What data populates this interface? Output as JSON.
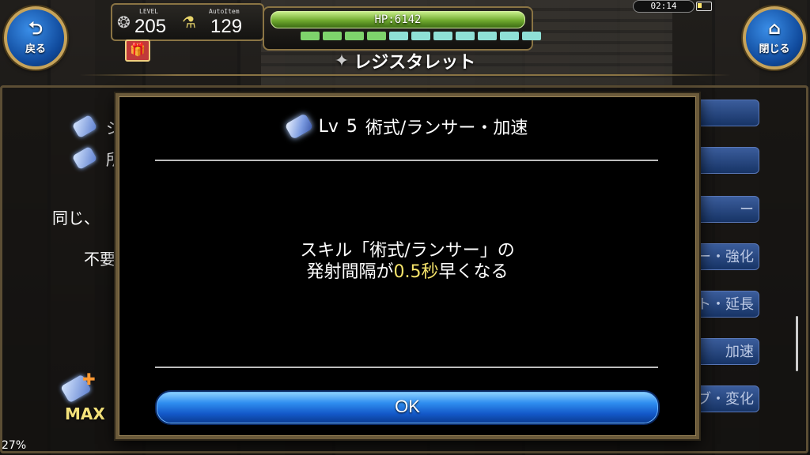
{
  "header": {
    "back_label": "戻る",
    "close_label": "閉じる",
    "level_label": "LEVEL",
    "level_value": "205",
    "autoitem_label": "AutoItem",
    "autoitem_value": "129",
    "hp_text": "HP:6142",
    "hp_segments": [
      "green",
      "green",
      "green",
      "green",
      "cyan",
      "cyan",
      "cyan",
      "cyan",
      "cyan",
      "cyan",
      "cyan"
    ],
    "clock": "02:14",
    "title": "レジスタレット"
  },
  "background": {
    "line1": "ジ",
    "line2": "所",
    "text1": "同じ、",
    "text2": "不要",
    "right_buttons": [
      "",
      "",
      "ー",
      "ー・強化",
      "ト・延長",
      "加速",
      "ブ・変化"
    ],
    "max_label": "MAX",
    "percent": "27%"
  },
  "modal": {
    "title_lv": "Lv",
    "title_level": "5",
    "title_name": "術式/ランサー・加速",
    "body_line1": "スキル「術式/ランサー」の",
    "body_line2_a": "発射間隔が",
    "body_line2_highlight": "0.5秒",
    "body_line2_b": "早くなる",
    "ok_label": "OK"
  },
  "colors": {
    "highlight": "#f5e36a",
    "ok_button": "#1358c8",
    "hp_green": "#6fa92e"
  }
}
